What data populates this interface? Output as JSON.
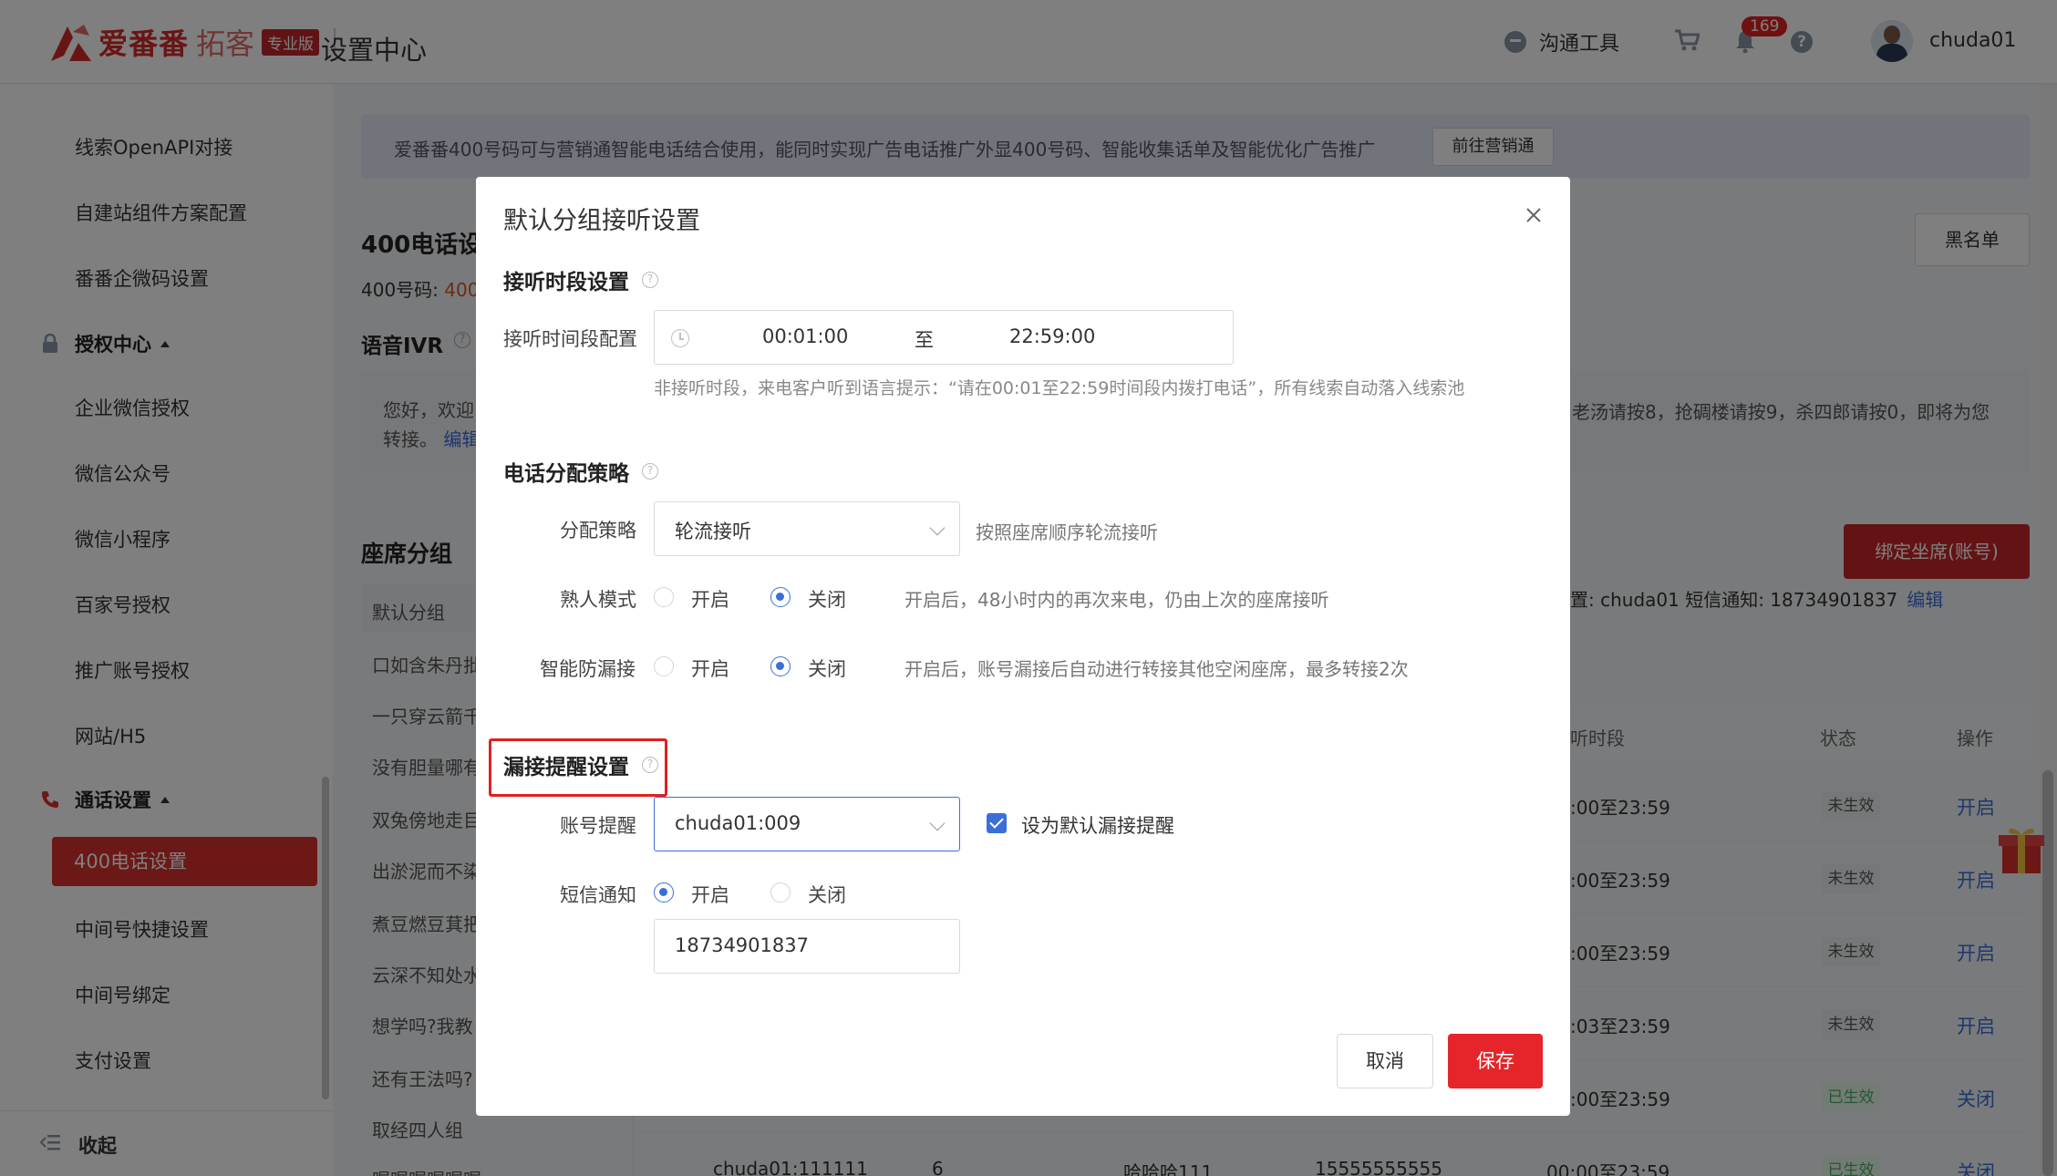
{
  "header": {
    "logo_text": "爱番番",
    "logo_sub": "拓客",
    "logo_badge": "专业版",
    "page_title": "设置中心",
    "comm_tool": "沟通工具",
    "notif_count": "169",
    "username": "chuda01"
  },
  "sidebar": {
    "items_top": [
      "线索OpenAPI对接",
      "自建站组件方案配置",
      "番番企微码设置"
    ],
    "group_auth": "授权中心",
    "auth_items": [
      "企业微信授权",
      "微信公众号",
      "微信小程序",
      "百家号授权",
      "推广账号授权",
      "网站/H5"
    ],
    "group_call": "通话设置",
    "call_active": "400电话设置",
    "call_items": [
      "中间号快捷设置",
      "中间号绑定",
      "支付设置"
    ],
    "collapse": "收起"
  },
  "main": {
    "banner_text": "爱番番400号码可与营销通智能电话结合使用，能同时实现广告电话推广外显400号码、智能收集话单及智能优化广告推广",
    "banner_btn": "前往营销通",
    "title": "400电话设",
    "sub_label": "400号码:",
    "sub_value": "400",
    "ivr_title": "语音IVR",
    "blacklist": "黑名单",
    "ivr_line1": "您好，欢迎",
    "ivr_line2": "转接。",
    "ivr_edit": "编辑",
    "ivr_right": "老汤请按8，抢碉楼请按9，杀四郎请按0，即将为您",
    "seat_title": "座席分组",
    "bind_btn": "绑定坐席(账号)",
    "groups": [
      "默认分组",
      "口如含朱丹批",
      "一只穿云箭千",
      "没有胆量哪有",
      "双兔傍地走目",
      "出淤泥而不染",
      "煮豆燃豆萁把",
      "云深不知处水",
      "想学吗?我教",
      "还有王法吗?",
      "取经四人组",
      "喔喔喔喔喔喔"
    ],
    "info_line": "置: chuda01 短信通知: 18734901837",
    "info_edit": "编辑",
    "th_time": "听时段",
    "th_status": "状态",
    "th_op": "操作",
    "rows": [
      {
        "time": ":00至23:59",
        "status": "未生效",
        "op": "开启"
      },
      {
        "time": ":00至23:59",
        "status": "未生效",
        "op": "开启"
      },
      {
        "time": ":00至23:59",
        "status": "未生效",
        "op": "开启"
      },
      {
        "time": ":03至23:59",
        "status": "未生效",
        "op": "开启"
      },
      {
        "time": ":00至23:59",
        "status": "已生效",
        "op": "关闭"
      }
    ],
    "last_row": {
      "account": "chuda01:111111",
      "num": "6",
      "name": "哈哈哈111",
      "phone": "15555555555",
      "time": "00:00至23:59",
      "status": "已生效",
      "op": "关闭"
    }
  },
  "modal": {
    "title": "默认分组接听设置",
    "sec1": "接听时段设置",
    "time_label": "接听时间段配置",
    "time_start": "00:01:00",
    "time_to": "至",
    "time_end": "22:59:00",
    "hint": "非接听时段，来电客户听到语言提示：“请在00:01至22:59时间段内拨打电话”，所有线索自动落入线索池",
    "sec2": "电话分配策略",
    "strategy_label": "分配策略",
    "strategy_value": "轮流接听",
    "strategy_desc": "按照座席顺序轮流接听",
    "acq_label": "熟人模式",
    "on": "开启",
    "off": "关闭",
    "acq_desc": "开启后，48小时内的再次来电，仍由上次的座席接听",
    "miss_label": "智能防漏接",
    "miss_desc": "开启后，账号漏接后自动进行转接其他空闲座席，最多转接2次",
    "sec3": "漏接提醒设置",
    "acct_label": "账号提醒",
    "acct_value": "chuda01:009",
    "default_cb": "设为默认漏接提醒",
    "sms_label": "短信通知",
    "phone": "18734901837",
    "cancel": "取消",
    "save": "保存"
  }
}
